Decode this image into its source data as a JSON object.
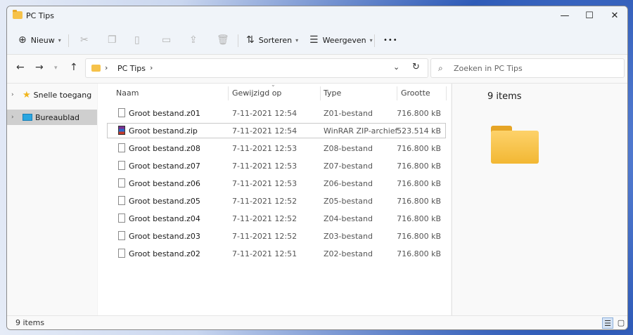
{
  "window": {
    "title": "PC Tips"
  },
  "controls": {
    "minimize": "—",
    "maximize": "☐",
    "close": "✕"
  },
  "toolbar": {
    "new_label": "Nieuw",
    "sort_label": "Sorteren",
    "view_label": "Weergeven",
    "more_label": "•••"
  },
  "address": {
    "crumbs": [
      "PC Tips"
    ],
    "search_placeholder": "Zoeken in PC Tips"
  },
  "nav_pane": [
    {
      "label": "Snelle toegang"
    },
    {
      "label": "Bureaublad"
    }
  ],
  "columns": {
    "name": "Naam",
    "modified": "Gewijzigd op",
    "type": "Type",
    "size": "Grootte"
  },
  "files": [
    {
      "name": "Groot bestand.z01",
      "modified": "7-11-2021 12:54",
      "type": "Z01-bestand",
      "size": "716.800 kB",
      "icon": "generic-file-icon"
    },
    {
      "name": "Groot bestand.zip",
      "modified": "7-11-2021 12:54",
      "type": "WinRAR ZIP-archief",
      "size": "523.514 kB",
      "icon": "winrar-icon"
    },
    {
      "name": "Groot bestand.z08",
      "modified": "7-11-2021 12:53",
      "type": "Z08-bestand",
      "size": "716.800 kB",
      "icon": "generic-file-icon"
    },
    {
      "name": "Groot bestand.z07",
      "modified": "7-11-2021 12:53",
      "type": "Z07-bestand",
      "size": "716.800 kB",
      "icon": "generic-file-icon"
    },
    {
      "name": "Groot bestand.z06",
      "modified": "7-11-2021 12:53",
      "type": "Z06-bestand",
      "size": "716.800 kB",
      "icon": "generic-file-icon"
    },
    {
      "name": "Groot bestand.z05",
      "modified": "7-11-2021 12:52",
      "type": "Z05-bestand",
      "size": "716.800 kB",
      "icon": "generic-file-icon"
    },
    {
      "name": "Groot bestand.z04",
      "modified": "7-11-2021 12:52",
      "type": "Z04-bestand",
      "size": "716.800 kB",
      "icon": "generic-file-icon"
    },
    {
      "name": "Groot bestand.z03",
      "modified": "7-11-2021 12:52",
      "type": "Z03-bestand",
      "size": "716.800 kB",
      "icon": "generic-file-icon"
    },
    {
      "name": "Groot bestand.z02",
      "modified": "7-11-2021 12:51",
      "type": "Z02-bestand",
      "size": "716.800 kB",
      "icon": "generic-file-icon"
    }
  ],
  "preview": {
    "count_text": "9 items"
  },
  "status": {
    "text": "9 items"
  }
}
